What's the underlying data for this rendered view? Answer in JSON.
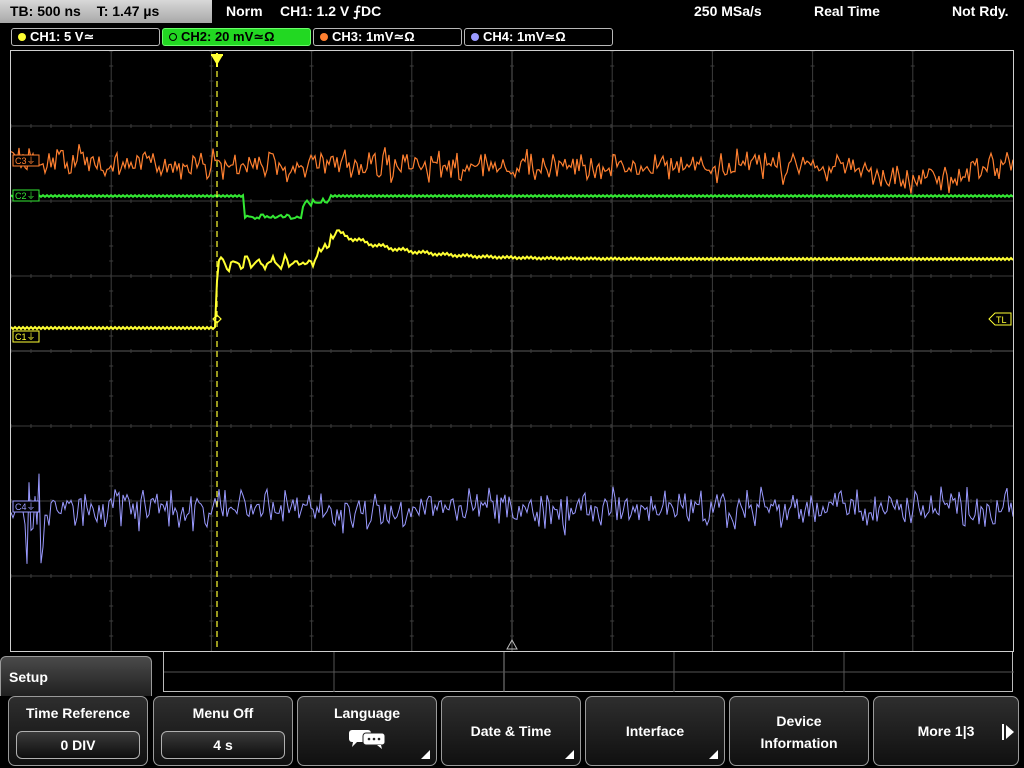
{
  "topbar": {
    "timebase": "TB: 500 ns",
    "trigger_time": "T: 1.47 µs",
    "mode": "Norm",
    "trigger_info": "CH1: 1.2 V  ⨍DC",
    "sample_rate": "250 MSa/s",
    "acq_mode": "Real Time",
    "status": "Not Rdy."
  },
  "channels": [
    {
      "label": "CH1: 5 V≃",
      "color": "#ffff33",
      "active": false
    },
    {
      "label": "CH2: 20 mV≃Ω",
      "color": "#33e833",
      "active": true
    },
    {
      "label": "CH3: 1mV≃Ω",
      "color": "#ff8030",
      "active": false
    },
    {
      "label": "CH4: 1mV≃Ω",
      "color": "#9a9aff",
      "active": false
    }
  ],
  "markers": {
    "ch1": "C1⏚",
    "ch2": "C2⏚",
    "ch3": "C3⏚",
    "ch4": "C4⏚",
    "trigger_level": "TL"
  },
  "menu": {
    "title": "Setup",
    "softkeys": [
      {
        "label": "Time Reference",
        "value": "0 DIV"
      },
      {
        "label": "Menu Off",
        "value": "4 s"
      },
      {
        "label": "Language",
        "icon": "speech-bubbles-icon"
      },
      {
        "label": "Date & Time"
      },
      {
        "label": "Interface"
      },
      {
        "label_line1": "Device",
        "label_line2": "Information"
      },
      {
        "label": "More 1|3"
      }
    ]
  },
  "trace_colors": {
    "ch1": "#ffff33",
    "ch2": "#33e833",
    "ch3": "#ff8030",
    "ch4": "#9a9aff",
    "grid": "#3c3c3c"
  }
}
